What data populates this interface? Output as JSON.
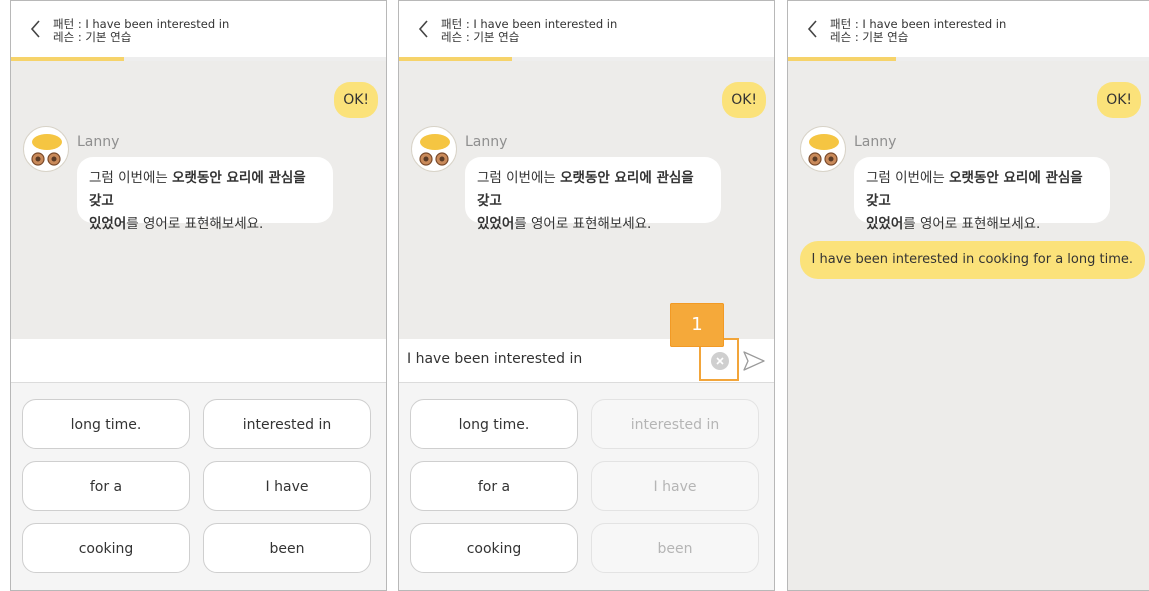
{
  "colors": {
    "accent_yellow": "#fbe27a",
    "progress": "#f6d36a",
    "chat_bg": "#edecea",
    "highlight": "#f5a93a"
  },
  "panels": [
    {
      "header": {
        "pattern": "패턴 : I have been interested in",
        "lesson": "레슨 : 기본 연습"
      },
      "progress": 0.3,
      "user_message": "OK!",
      "bot": {
        "name": "Lanny",
        "text_1": "그럼 이번에는 ",
        "bold_1": "오랫동안 요리에 관심을 갖고",
        "bold_2": "있었어",
        "text_2": "를 영어로 표현해보세요."
      },
      "input": "",
      "words": [
        {
          "label": "long time.",
          "used": false
        },
        {
          "label": "interested in",
          "used": false
        },
        {
          "label": "for a",
          "used": false
        },
        {
          "label": "I have",
          "used": false
        },
        {
          "label": "cooking",
          "used": false
        },
        {
          "label": "been",
          "used": false
        }
      ]
    },
    {
      "header": {
        "pattern": "패턴 : I have been interested in",
        "lesson": "레슨 : 기본 연습"
      },
      "progress": 0.3,
      "user_message": "OK!",
      "bot": {
        "name": "Lanny",
        "text_1": "그럼 이번에는 ",
        "bold_1": "오랫동안 요리에 관심을 갖고",
        "bold_2": "있었어",
        "text_2": "를 영어로 표현해보세요."
      },
      "input": "I have been interested in",
      "marker": "1",
      "words": [
        {
          "label": "long time.",
          "used": false
        },
        {
          "label": "interested in",
          "used": true
        },
        {
          "label": "for a",
          "used": false
        },
        {
          "label": "I have",
          "used": true
        },
        {
          "label": "cooking",
          "used": false
        },
        {
          "label": "been",
          "used": true
        }
      ]
    },
    {
      "header": {
        "pattern": "패턴 : I have been interested in",
        "lesson": "레슨 : 기본 연습"
      },
      "progress": 0.3,
      "user_message": "OK!",
      "bot": {
        "name": "Lanny",
        "text_1": "그럼 이번에는 ",
        "bold_1": "오랫동안 요리에 관심을 갖고",
        "bold_2": "있었어",
        "text_2": "를 영어로 표현해보세요."
      },
      "answer": "I have been interested in cooking for a long time."
    }
  ],
  "icons": {
    "back": "chevron-left-icon",
    "clear": "clear-circle-icon",
    "send": "send-icon",
    "avatar": "egg-character-avatar"
  }
}
